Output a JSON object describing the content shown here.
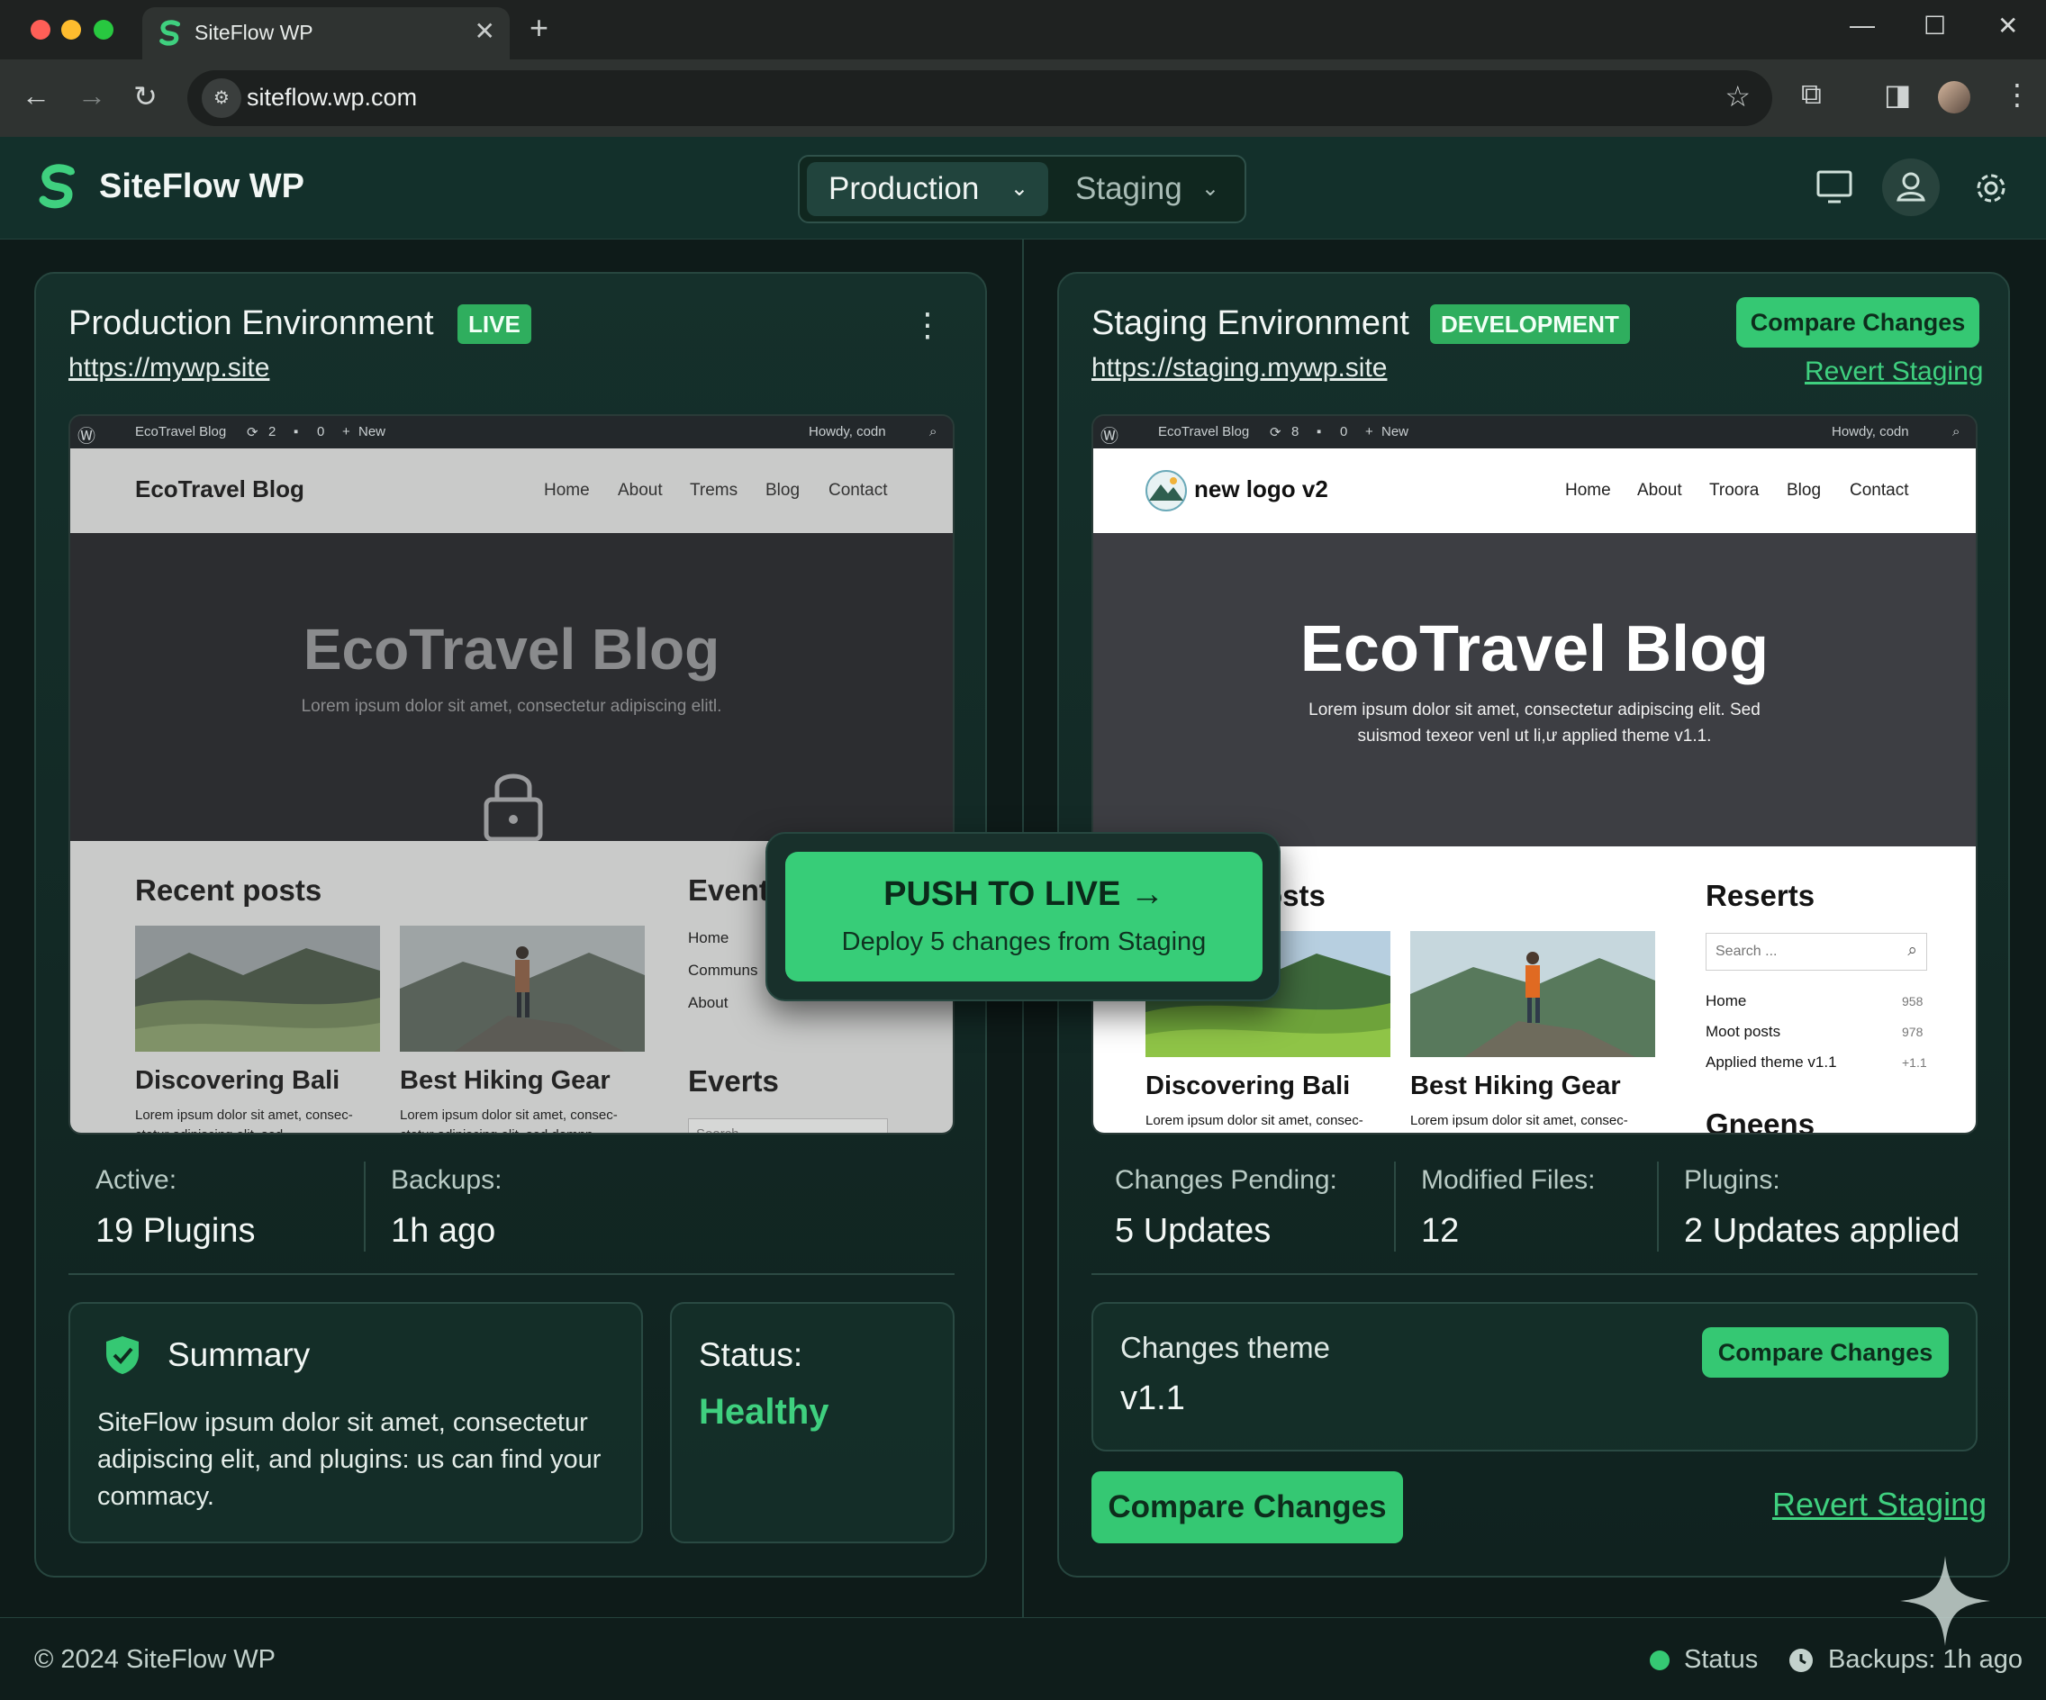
{
  "browser": {
    "tab_title": "SiteFlow WP",
    "url": "siteflow.wp.com",
    "close_glyph": "✕",
    "new_tab_glyph": "+"
  },
  "app": {
    "brand": "SiteFlow WP",
    "env_tabs": [
      {
        "label": "Production",
        "active": true
      },
      {
        "label": "Staging",
        "active": false
      }
    ]
  },
  "production": {
    "title": "Production Environment",
    "badge": "LIVE",
    "url": "https://mywp.site",
    "preview": {
      "wpbar": {
        "site": "EcoTravel Blog",
        "updates": "2",
        "comments": "0",
        "new": "New",
        "howdy": "Howdy, codn"
      },
      "site_name": "EcoTravel Blog",
      "menu": [
        "Home",
        "About",
        "Trems",
        "Blog",
        "Contact"
      ],
      "hero_title": "EcoTravel Blog",
      "hero_sub": "Lorem ipsum dolor sit amet, consectetur adipiscing elitl.",
      "recent_title": "Recent posts",
      "posts": [
        {
          "title": "Discovering Bali",
          "excerpt": "Lorem ipsum dolor sit amet, consec- ctetur adipiscing elit, sed"
        },
        {
          "title": "Best Hiking Gear",
          "excerpt": "Lorem ipsum dolor sit amet, consec- ctetur adipiscing elit, sed domnn"
        }
      ],
      "side_title": "Event",
      "side_links": [
        "Home",
        "Communs",
        "About"
      ],
      "side_title2": "Everts",
      "search_placeholder": "Search ..."
    },
    "stats": [
      {
        "label": "Active:",
        "value": "19 Plugins"
      },
      {
        "label": "Backups:",
        "value": "1h ago"
      }
    ],
    "summary": {
      "title": "Summary",
      "text": "SiteFlow ipsum dolor sit amet, consectetur adipiscing elit, and plugins: us can find your commacy."
    },
    "status": {
      "label": "Status:",
      "value": "Healthy"
    }
  },
  "staging": {
    "title": "Staging Environment",
    "badge": "DEVELOPMENT",
    "url": "https://staging.mywp.site",
    "compare_label": "Compare Changes",
    "revert_label": "Revert Staging",
    "preview": {
      "wpbar": {
        "site": "EcoTravel Blog",
        "updates": "8",
        "comments": "0",
        "new": "New",
        "howdy": "Howdy, codn"
      },
      "site_name": "new logo v2",
      "menu": [
        "Home",
        "About",
        "Troora",
        "Blog",
        "Contact"
      ],
      "hero_title": "EcoTravel Blog",
      "hero_sub1": "Lorem ipsum dolor sit amet, consectetur adipiscing elit. Sed",
      "hero_sub2": "suismod texeor venl ut li,ư applied theme v1.1.",
      "recent_title": "osts",
      "posts": [
        {
          "title": "Discovering Bali",
          "excerpt": "Lorem ipsum dolor sit amet, consec- ctetur adipiscing elit, sed"
        },
        {
          "title": "Best Hiking Gear",
          "excerpt": "Lorem ipsum dolor sit amet, consec- ctetur adipiscing elit, sed domnn"
        }
      ],
      "side_title": "Reserts",
      "search_placeholder": "Search ...",
      "side_list": [
        {
          "label": "Home",
          "count": "958"
        },
        {
          "label": "Moot posts",
          "count": "978"
        },
        {
          "label": "Applied theme v1.1",
          "count": "+1.1"
        }
      ],
      "side_title2": "Gneens"
    },
    "stats": [
      {
        "label": "Changes Pending:",
        "value": "5 Updates"
      },
      {
        "label": "Modified Files:",
        "value": "12"
      },
      {
        "label": "Plugins:",
        "value": "2 Updates applied"
      }
    ],
    "theme_card": {
      "title": "Changes theme",
      "version": "v1.1",
      "button": "Compare Changes"
    },
    "bottom_compare": "Compare Changes",
    "bottom_revert": "Revert Staging"
  },
  "push": {
    "title": "PUSH TO LIVE →",
    "subtitle": "Deploy 5 changes from Staging"
  },
  "footer": {
    "copyright": "© 2024 SiteFlow WP",
    "status": "Status",
    "backups": "Backups: 1h ago"
  },
  "colors": {
    "accent": "#35c873",
    "background": "#0e1b19",
    "panel": "#15302b",
    "status_ok": "#35c873"
  },
  "icons": [
    "siteflow-logo-icon",
    "monitor-icon",
    "user-icon",
    "gear-icon",
    "kebab-menu-icon",
    "lock-icon",
    "shield-check-icon",
    "clock-icon",
    "sparkle-icon"
  ]
}
